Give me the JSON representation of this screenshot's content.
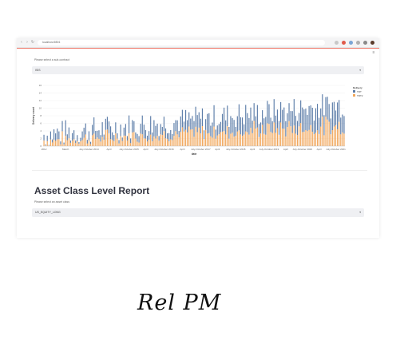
{
  "browser": {
    "url": "localhost:8501"
  },
  "report_top": {
    "prompt_label": "Please select a sub-contract",
    "selected_value": "ISIS"
  },
  "asset_report": {
    "title": "Asset Class Level Report",
    "prompt_label": "Please select an asset class",
    "selected_value": "US_EQUITY_LONG"
  },
  "caption": "Rel PM",
  "colors": {
    "series_a": "#5b7ca8",
    "series_b": "#f1a65a",
    "section_title": "#31333f",
    "accent_line": "#e94e3c"
  },
  "chart_data": {
    "type": "bar",
    "stacked": true,
    "x": [
      "2012",
      "",
      "",
      "",
      "",
      "",
      "",
      "",
      "",
      "",
      "",
      "",
      "",
      "March",
      "",
      "",
      "",
      "",
      "",
      "",
      "",
      "",
      "",
      "",
      "",
      "",
      "",
      "July-October 2014",
      "",
      "",
      "",
      "",
      "",
      "",
      "",
      "",
      "",
      "",
      "",
      "April",
      "",
      "",
      "",
      "",
      "",
      "",
      "",
      "",
      "",
      "",
      "",
      "July-October 2015",
      "",
      "",
      "",
      "",
      "",
      "",
      "",
      "",
      "",
      "April",
      "",
      "",
      "",
      "",
      "",
      "",
      "",
      "",
      "",
      "",
      "July-October 2016",
      "",
      "",
      "",
      "",
      "",
      "",
      "",
      "",
      "",
      "",
      "April",
      "",
      "",
      "",
      "",
      "",
      "",
      "",
      "",
      "",
      "",
      "July-October 2017",
      "",
      "",
      "",
      "",
      "",
      "",
      "",
      "",
      "",
      "April",
      "",
      "",
      "",
      "",
      "",
      "",
      "",
      "",
      "",
      "",
      "July-October 2018",
      "",
      "",
      "",
      "",
      "",
      "",
      "",
      "",
      "",
      "April",
      "",
      "",
      "",
      "",
      "",
      "",
      "",
      "",
      "",
      "July-October 2019",
      "",
      "",
      "",
      "",
      "",
      "",
      "",
      "",
      "",
      "April",
      "",
      "",
      "",
      "",
      "",
      "",
      "",
      "",
      "",
      "July-October 2020",
      "",
      "",
      "",
      "",
      "",
      "",
      "",
      "",
      "",
      "April",
      "",
      "",
      "",
      "",
      "",
      "",
      "",
      "",
      "",
      "July-October 2021",
      "",
      "",
      "",
      "",
      ""
    ],
    "tick_labels": [
      "2012",
      "March",
      "July-October 2014",
      "April",
      "July-October 2015",
      "April",
      "July-October 2016",
      "April",
      "July-October 2017",
      "April",
      "July-October 2018",
      "April",
      "July-October 2019",
      "April",
      "July-October 2020",
      "April",
      "July-October 2021"
    ],
    "xlabel": "date",
    "ylabel": "Delivery count",
    "yticks": [
      0,
      2,
      4,
      6,
      8,
      10,
      12,
      14,
      16
    ],
    "ylim": [
      0,
      16
    ],
    "grid": true,
    "legend_title": "Delivery",
    "legend_position": "top-right",
    "series": [
      {
        "name": "TRT",
        "color": "#5b7ca8"
      },
      {
        "name": "TRT2",
        "color": "#f1a65a"
      }
    ]
  }
}
